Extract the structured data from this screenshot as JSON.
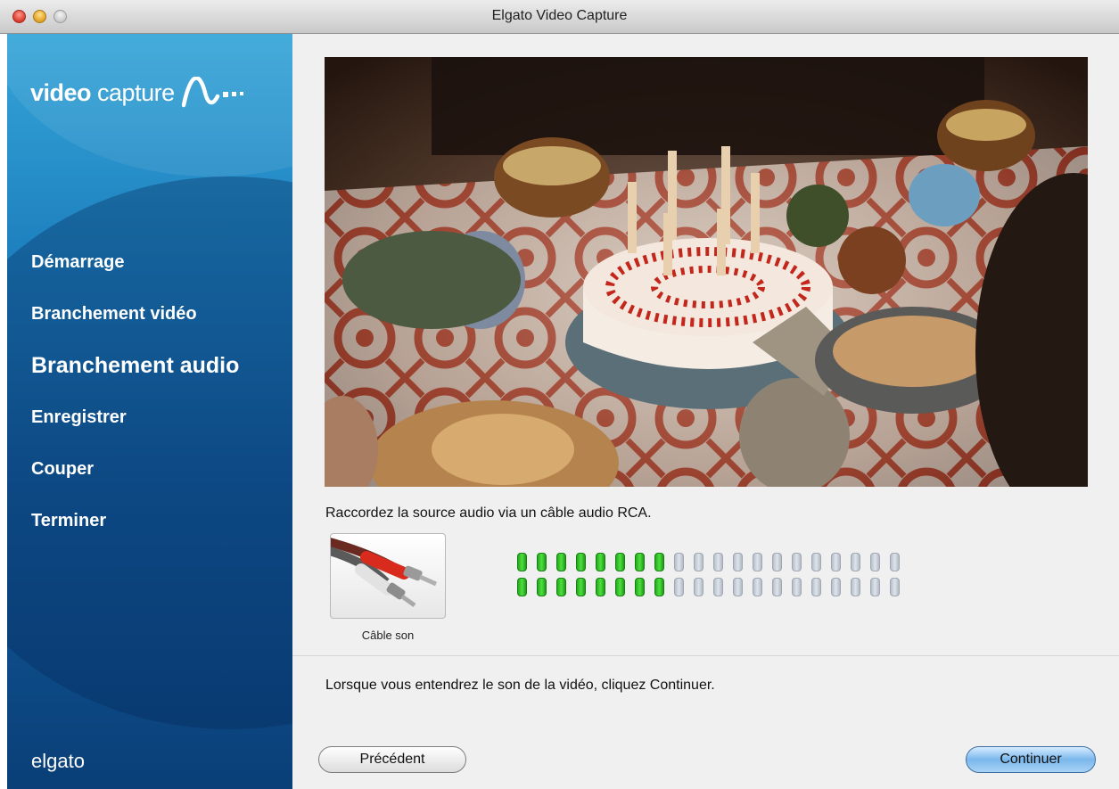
{
  "window": {
    "title": "Elgato Video Capture"
  },
  "sidebar": {
    "logo_bold": "video",
    "logo_light": "capture",
    "items": [
      {
        "label": "Démarrage"
      },
      {
        "label": "Branchement vidéo"
      },
      {
        "label": "Branchement audio",
        "active": true
      },
      {
        "label": "Enregistrer"
      },
      {
        "label": "Couper"
      },
      {
        "label": "Terminer"
      }
    ],
    "brand": "elgato"
  },
  "main": {
    "instruction": "Raccordez la source audio via un câble audio RCA.",
    "cable_label": "Câble son",
    "audio_meter": {
      "segments": 20,
      "left_level": 0.4,
      "right_level": 0.4
    },
    "message": "Lorsque vous entendrez le son de la vidéo, cliquez Continuer.",
    "prev_label": "Précédent",
    "next_label": "Continuer"
  },
  "colors": {
    "meter_on": "#3cc82f",
    "meter_off": "#c9d0d9",
    "sidebar_top": "#35a5d8",
    "sidebar_bottom": "#0a3f77"
  },
  "icons": [
    "rca-cable-icon",
    "waveform-logo-icon"
  ]
}
